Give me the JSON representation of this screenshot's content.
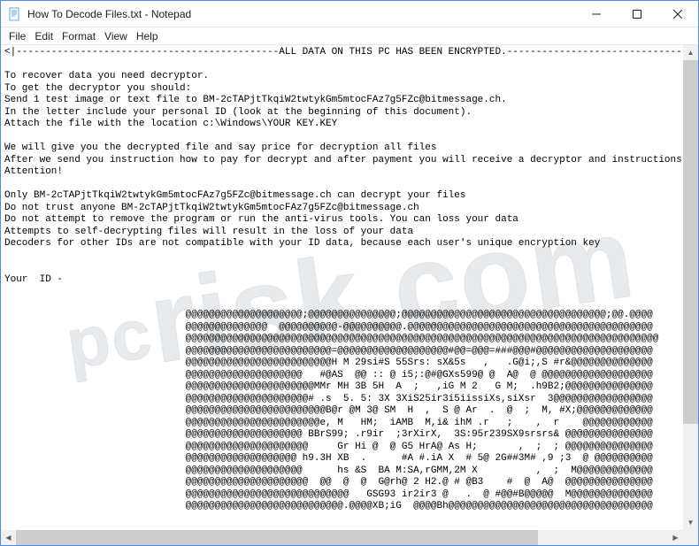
{
  "window": {
    "title": "How To Decode Files.txt - Notepad"
  },
  "menu": {
    "file": "File",
    "edit": "Edit",
    "format": "Format",
    "view": "View",
    "help": "Help"
  },
  "body": {
    "lines": [
      "<|---------------------------------------------ALL DATA ON THIS PC HAS BEEN ENCRYPTED.---------------------------------",
      "",
      "To recover data you need decryptor.",
      "To get the decryptor you should:",
      "Send 1 test image or text file to BM-2cTAPjtTkqiW2twtykGm5mtocFAz7g5FZc@bitmessage.ch.",
      "In the letter include your personal ID (look at the beginning of this document).",
      "Attach the file with the location c:\\Windows\\YOUR KEY.KEY",
      "",
      "We will give you the decrypted file and say price for decryption all files",
      "After we send you instruction how to pay for decrypt and after payment you will receive a decryptor and instructions We",
      "Attention!",
      "",
      "Only BM-2cTAPjtTkqiW2twtykGm5mtocFAz7g5FZc@bitmessage.ch can decrypt your files",
      "Do not trust anyone BM-2cTAPjtTkqiW2twtykGm5mtocFAz7g5FZc@bitmessage.ch",
      "Do not attempt to remove the program or run the anti-virus tools. You can loss your data",
      "Attempts to self-decrypting files will result in the loss of your data",
      "Decoders for other IDs are not compatible with your ID data, because each user's unique encryption key",
      "",
      "",
      "Your  ID -",
      "",
      "",
      "                               @@@@@@@@@@@@@@@@@@@@;@@@@@@@@@@@@@@@;@@@@@@@@@@@@@@@@@@@@@@@@@@@@@@@@@@@;@@.@@@@",
      "                               @@@@@@@@@@@@@@  @@@@@@@@@@-@@@@@@@@@@.@@@@@@@@@@@@@@@@@@@@@@@@@@@@@@@@@@@@@@@@@@",
      "                               @@@@@@@@@@@@@@@@@@@@@@@@@@@@@@@@@@@@@@@@@@@@@@@@@@@@@@@@@@@@@@@@@@@@@@@@@@@@@@@@@",
      "                               @@@@@@@@@@@@@@@@@@@@@@@@@=@@@@@@@@@@@@@@@@@@@#@@=@@@=###@@@#@@@@@@@@@@@@@@@@@@@@",
      "                               @@@@@@@@@@@@@@@@@@@@@@@@@H M 29si#S 55Srs: sX&5s   ,   .G@i;,S #r&@@@@@@@@@@@@@@",
      "                               @@@@@@@@@@@@@@@@@@@@   #@AS  @@ :: @ i5;:@#@GXs599@ @  A@  @ @@@@@@@@@@@@@@@@@@@",
      "                               @@@@@@@@@@@@@@@@@@@@@@MMr MH 3B 5H  A  ;   ,iG M 2   G M;  .h9B2;@@@@@@@@@@@@@@@",
      "                               @@@@@@@@@@@@@@@@@@@@@# .s  5. 5: 3X 3XiS25ir3i5iissiXs,siXsr  3@@@@@@@@@@@@@@@@@",
      "                               @@@@@@@@@@@@@@@@@@@@@@@@B@r @M 3@ SM  H  ,  S @ Ar  .  @  ;  M, #X;@@@@@@@@@@@@@",
      "                               @@@@@@@@@@@@@@@@@@@@@@@e, M   HM;  iAMB  M,i& ihM .r   ;    ,  r    @@@@@@@@@@@@",
      "                               @@@@@@@@@@@@@@@@@@@@ BBrS99; .r9ir  ;3rXirX,  3S:95r239SX9srsrs& @@@@@@@@@@@@@@@",
      "                               @@@@@@@@@@@@@@@@@@@@@     Gr Hi @  @ G5 HrA@ As H;       ,  ;  ; @@@@@@@@@@@@@@@",
      "                               @@@@@@@@@@@@@@@@@@@ h9.3H XB  .      #A #.iA X  # 5@ 2G##3M# ,9 ;3  @ @@@@@@@@@@",
      "                               @@@@@@@@@@@@@@@@@@@@      hs &S  BA M:SA,rGMM,2M X          ,  ;  M@@@@@@@@@@@@@",
      "                               @@@@@@@@@@@@@@@@@@@@@  @@  @  @  G@rh@ 2 H2.@ # @B3    #  @  A@  @@@@@@@@@@@@@@@",
      "                               @@@@@@@@@@@@@@@@@@@@@@@@@@@@   GSG93 ir2ir3 @   .  @ #@@#B@@@@@  M@@@@@@@@@@@@@@",
      "                               @@@@@@@@@@@@@@@@@@@@@@@@@@@.@@@@XB;iG  @@@@Bh@@@@@@@@@@@@@@@@@@@@@@@@@@@@@@@@@@@"
    ]
  },
  "icons": {
    "notepad": "notepad-icon",
    "minimize": "minimize-icon",
    "maximize": "maximize-icon",
    "close": "close-icon"
  }
}
